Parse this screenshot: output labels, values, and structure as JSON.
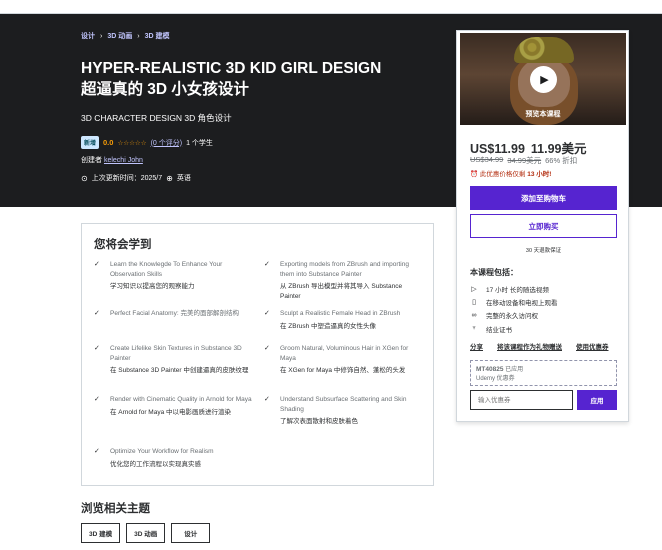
{
  "breadcrumb": [
    "设计",
    "3D 动画",
    "3D 建模"
  ],
  "course": {
    "title_en": "HYPER-REALISTIC 3D KID GIRL DESIGN",
    "title_zh": "超逼真的 3D 小女孩设计",
    "subtitle": "3D CHARACTER DESIGN  3D 角色设计",
    "badge": "新增",
    "rating": "0.0",
    "stars": "☆☆☆☆☆",
    "ratings_link": "(0 个评分)",
    "students": "1 个学生",
    "rating_value": 0,
    "creator_label": "创建者",
    "creator_name": "kelechi John",
    "updated": "上次更新时间：2025/7",
    "language": "英语"
  },
  "learn": {
    "title": "您将会学到",
    "items": [
      {
        "en": "Learn the Knowlegde To Enhance Your Observation Skills",
        "zh": "学习知识以提高您的观察能力"
      },
      {
        "en": "Exporting models from ZBrush and importing them into Substance Painter",
        "zh": "从 ZBrush 导出模型并将其导入 Substance Painter"
      },
      {
        "en": "Perfect Facial Anatomy: 完美的面部解剖结构",
        "zh": ""
      },
      {
        "en": "Sculpt a Realistic Female Head in ZBrush",
        "zh": "在 ZBrush 中塑造逼真的女性头像"
      },
      {
        "en": "Create Lifelike Skin Textures in Substance 3D Painter",
        "zh": "在 Substance 3D Painter 中创建逼真的皮肤纹理"
      },
      {
        "en": "Groom Natural, Voluminous Hair in XGen for Maya",
        "zh": "在 XGen for Maya 中修饰自然、蓬松的头发"
      },
      {
        "en": "Render with Cinematic Quality in Arnold for Maya",
        "zh": "在 Arnold for Maya 中以电影画质进行渲染"
      },
      {
        "en": "Understand Subsurface Scattering and Skin Shading",
        "zh": "了解次表面散射和皮肤着色"
      },
      {
        "en": "Optimize Your Workflow for Realism",
        "zh": "优化您的工作流程以实现真实感"
      }
    ]
  },
  "browse": {
    "title": "浏览相关主题",
    "chips": [
      "3D 建模",
      "3D 动画",
      "设计"
    ]
  },
  "sidebar": {
    "preview_label": "预览本课程",
    "price": "US$11.99",
    "price_alt": "11.99美元",
    "old_price": "US$34.99",
    "old_price_alt": "34.99美元",
    "discount": "66% 折扣",
    "timer_prefix": "此优惠价格仅剩",
    "timer_value": "13 小时!",
    "add_to_cart": "添加至购物车",
    "buy_now": "立即购买",
    "guarantee": "30 天退款保证",
    "includes_title": "本课程包括：",
    "includes": [
      {
        "icon": "video-icon",
        "glyph": "▷",
        "text": "17 小时 长的随选视频"
      },
      {
        "icon": "mobile-icon",
        "glyph": "▯",
        "text": "在移动设备和电视上观看"
      },
      {
        "icon": "infinity-icon",
        "glyph": "∞",
        "text": "完整的永久访问权"
      },
      {
        "icon": "trophy-icon",
        "glyph": "♆",
        "text": "结业证书"
      }
    ],
    "links": [
      "分享",
      "将该课程作为礼物赠送",
      "使用优惠券"
    ],
    "coupon_code": "MT40825",
    "coupon_status": "已应用",
    "coupon_note": "Udemy 优惠券",
    "coupon_placeholder": "输入优惠券",
    "apply_label": "应用"
  },
  "colors": {
    "hero_bg": "#1c1d1f",
    "accent": "#5624d0",
    "link": "#c0c4fc",
    "star": "#f69c08",
    "alert": "#b32d0f"
  }
}
